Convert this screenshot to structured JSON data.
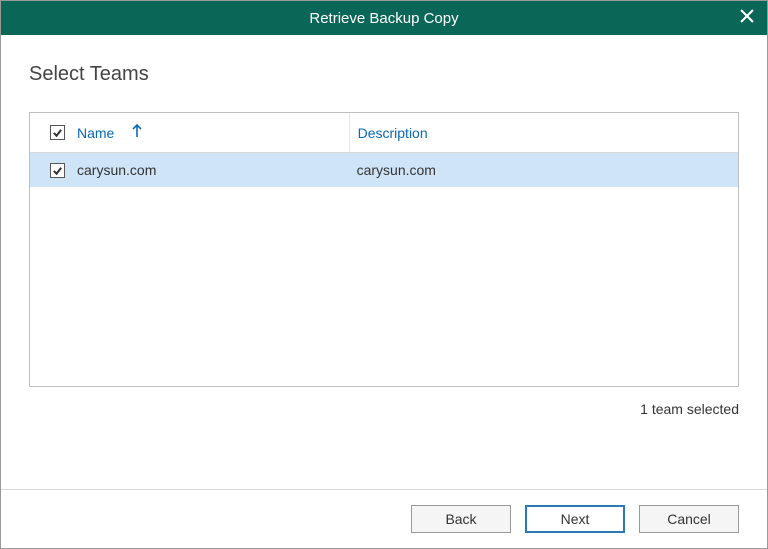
{
  "titlebar": {
    "title": "Retrieve Backup Copy"
  },
  "page": {
    "heading": "Select Teams"
  },
  "grid": {
    "header": {
      "name": "Name",
      "description": "Description"
    },
    "rows": [
      {
        "name": "carysun.com",
        "description": "carysun.com",
        "checked": true
      }
    ]
  },
  "status": "1 team selected",
  "buttons": {
    "back": "Back",
    "next": "Next",
    "cancel": "Cancel"
  }
}
